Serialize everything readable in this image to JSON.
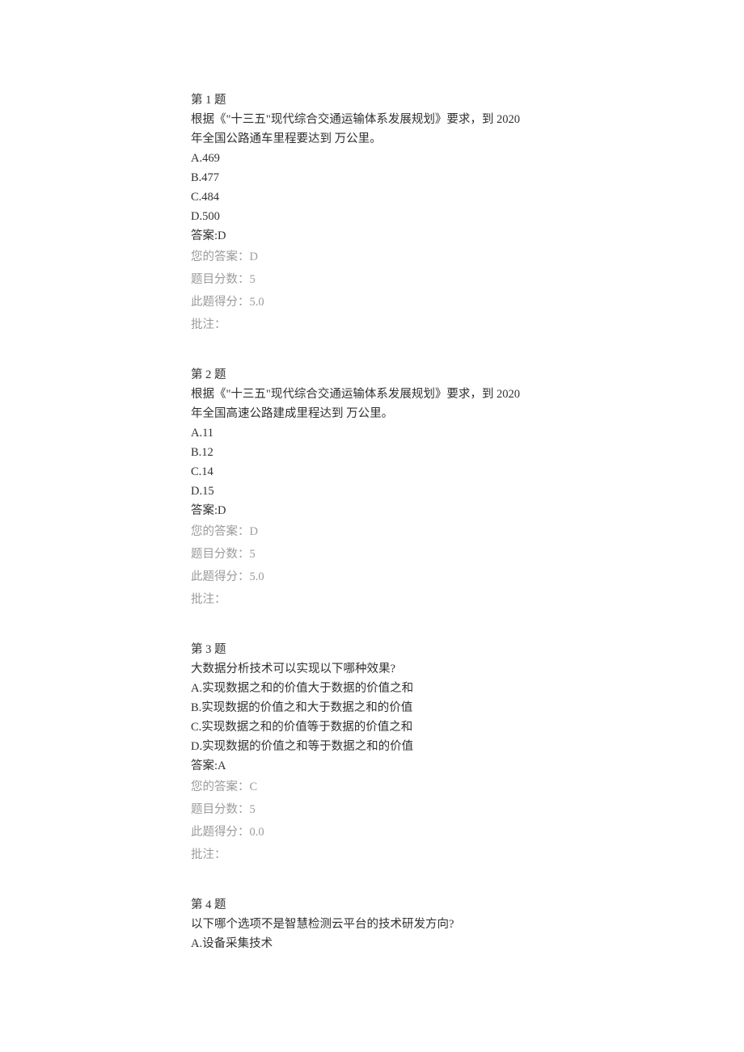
{
  "labels": {
    "question_prefix": "第 ",
    "question_suffix": " 题",
    "answer_prefix": "答案:",
    "your_answer": "您的答案：",
    "score_label": "题目分数：",
    "earned_label": "此题得分：",
    "note_label": "批注："
  },
  "questions": [
    {
      "number": "1",
      "prompt_lines": [
        "根据《\"十三五\"现代综合交通运输体系发展规划》要求，到 2020",
        "年全国公路通车里程要达到 万公里。"
      ],
      "options": [
        "A.469",
        "B.477",
        "C.484",
        "D.500"
      ],
      "answer": "D",
      "your_answer": "D",
      "score": "5",
      "earned": "5.0",
      "note": ""
    },
    {
      "number": "2",
      "prompt_lines": [
        "根据《\"十三五\"现代综合交通运输体系发展规划》要求，到 2020",
        "年全国高速公路建成里程达到 万公里。"
      ],
      "options": [
        "A.11",
        "B.12",
        "C.14",
        "D.15"
      ],
      "answer": "D",
      "your_answer": "D",
      "score": "5",
      "earned": "5.0",
      "note": ""
    },
    {
      "number": "3",
      "prompt_lines": [
        "大数据分析技术可以实现以下哪种效果?"
      ],
      "options": [
        "A.实现数据之和的价值大于数据的价值之和",
        "B.实现数据的价值之和大于数据之和的价值",
        "C.实现数据之和的价值等于数据的价值之和",
        "D.实现数据的价值之和等于数据之和的价值"
      ],
      "answer": "A",
      "your_answer": "C",
      "score": "5",
      "earned": "0.0",
      "note": ""
    },
    {
      "number": "4",
      "prompt_lines": [
        "以下哪个选项不是智慧检测云平台的技术研发方向?"
      ],
      "options": [
        "A.设备采集技术"
      ],
      "answer": null,
      "your_answer": null,
      "score": null,
      "earned": null,
      "note": null
    }
  ]
}
